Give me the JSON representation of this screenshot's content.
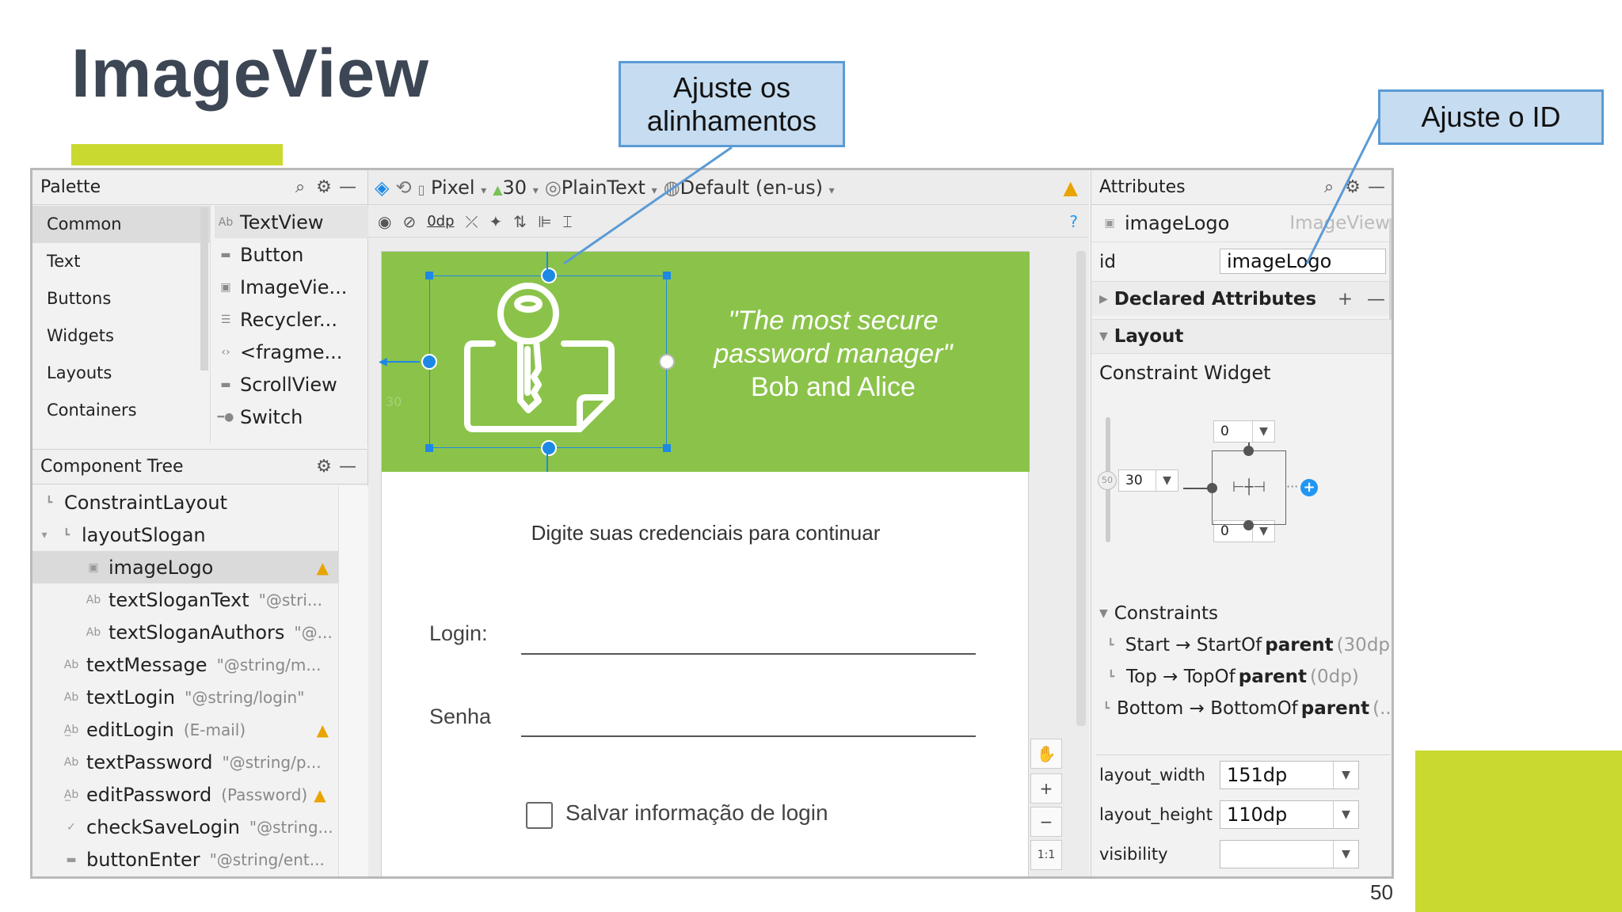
{
  "slide": {
    "title": "ImageView",
    "page_number": "50",
    "accent_color": "#c9d92f",
    "callouts": {
      "align": "Ajuste os alinhamentos",
      "id": "Ajuste o ID"
    }
  },
  "palette": {
    "title": "Palette",
    "categories": [
      "Common",
      "Text",
      "Buttons",
      "Widgets",
      "Layouts",
      "Containers"
    ],
    "items": [
      "TextView",
      "Button",
      "ImageVie...",
      "Recycler...",
      "<fragme...",
      "ScrollView",
      "Switch"
    ]
  },
  "tree": {
    "title": "Component Tree",
    "nodes": [
      {
        "name": "ConstraintLayout",
        "sub": ""
      },
      {
        "name": "layoutSlogan",
        "sub": ""
      },
      {
        "name": "imageLogo",
        "sub": ""
      },
      {
        "name": "textSloganText",
        "sub": "\"@stri..."
      },
      {
        "name": "textSloganAuthors",
        "sub": "\"@..."
      },
      {
        "name": "textMessage",
        "sub": "\"@string/m..."
      },
      {
        "name": "textLogin",
        "sub": "\"@string/login\""
      },
      {
        "name": "editLogin",
        "sub": "(E-mail)"
      },
      {
        "name": "textPassword",
        "sub": "\"@string/p..."
      },
      {
        "name": "editPassword",
        "sub": "(Password)"
      },
      {
        "name": "checkSaveLogin",
        "sub": "\"@string..."
      },
      {
        "name": "buttonEnter",
        "sub": "\"@string/ent..."
      }
    ]
  },
  "toolbar": {
    "device": "Pixel",
    "api": "30",
    "theme": "PlainText",
    "locale": "Default (en-us)",
    "margin": "0dp"
  },
  "preview": {
    "slogan_quote": "\"The most secure password manager\"",
    "slogan_authors": "Bob and Alice",
    "margin_hint": "30",
    "message": "Digite suas credenciais para continuar",
    "login_label": "Login:",
    "password_label": "Senha",
    "checkbox_label": "Salvar informação de login",
    "zoom_reset": "1:1",
    "banner_color": "#8bc34a"
  },
  "attributes": {
    "title": "Attributes",
    "component_name": "imageLogo",
    "component_type": "ImageView",
    "id_label": "id",
    "id_value": "imageLogo",
    "declared": "Declared Attributes",
    "layout": "Layout",
    "constraint_widget": "Constraint Widget",
    "margin_top": "0",
    "margin_start": "30",
    "margin_start_hint": "50",
    "margin_bottom": "0",
    "constraints_title": "Constraints",
    "constraints": [
      {
        "a": "Start",
        "b": "StartOf",
        "c": "parent",
        "d": "(30dp)"
      },
      {
        "a": "Top",
        "b": "TopOf",
        "c": "parent",
        "d": "(0dp)"
      },
      {
        "a": "Bottom",
        "b": "BottomOf",
        "c": "parent",
        "d": "(..."
      }
    ],
    "layout_width_label": "layout_width",
    "layout_width": "151dp",
    "layout_height_label": "layout_height",
    "layout_height": "110dp",
    "visibility_label": "visibility"
  }
}
